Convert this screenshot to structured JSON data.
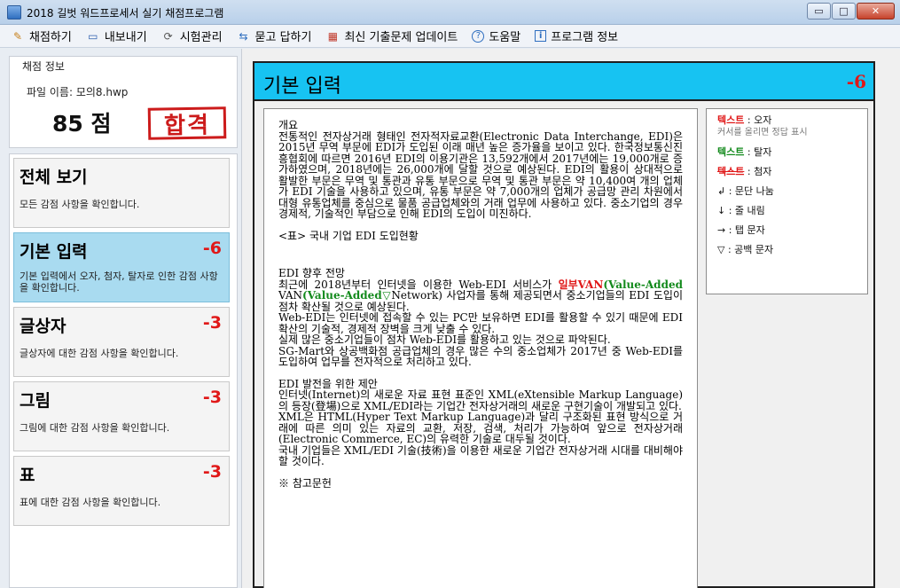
{
  "window": {
    "title": "2018 길벗 워드프로세서 실기 채점프로그램",
    "min": "▭",
    "max": "□",
    "close": "✕"
  },
  "menu": [
    {
      "icon": "✎",
      "label": "채점하기"
    },
    {
      "icon": "▭",
      "label": "내보내기"
    },
    {
      "icon": "⟳",
      "label": "시험관리"
    },
    {
      "icon": "⇆",
      "label": "묻고 답하기"
    },
    {
      "icon": "▦",
      "label": "최신 기출문제 업데이트"
    },
    {
      "icon": "?",
      "label": "도움말"
    },
    {
      "icon": "i",
      "label": "프로그램 정보"
    }
  ],
  "score_panel": {
    "legend": "채점 정보",
    "filename": "파일 이름: 모의8.hwp",
    "score": "85 점",
    "result": "합격"
  },
  "cards": [
    {
      "title": "전체 보기",
      "score": "",
      "desc": "모든 감점 사항을 확인합니다."
    },
    {
      "title": "기본 입력",
      "score": "-6",
      "desc": "기본 입력에서 오자, 첨자, 탈자로 인한 감점 사항을 확인합니다."
    },
    {
      "title": "글상자",
      "score": "-3",
      "desc": "글상자에 대한 감점 사항을 확인합니다."
    },
    {
      "title": "그림",
      "score": "-3",
      "desc": "그림에 대한 감점 사항을 확인합니다."
    },
    {
      "title": "표",
      "score": "-3",
      "desc": "표에 대한 감점 사항을 확인합니다."
    }
  ],
  "panel": {
    "title": "기본 입력",
    "score": "-6"
  },
  "doc": {
    "h1": "개요",
    "p1": "전통적인 전자상거래 형태인 전자적자료교환(Electronic Data Interchange, EDI)은 2015년 무역 부문에 EDI가 도입된 이래 매년 높은 증가율을 보이고 있다. 한국정보통신진흥협회에 따르면 2016년 EDI의 이용기관은 13,592개에서 2017년에는 19,000개로 증가하였으며, 2018년에는 26,000개에 달할 것으로 예상된다. EDI의 활용이 상대적으로 활발한 부문은 무역 및 통관과 유통 부문으로 무역 및 통관 부문은 약 10,400여 개의 업체가 EDI 기술을 사용하고 있으며, 유통 부문은 약 7,000개의 업체가 공급망 관리 차원에서 대형 유통업체를 중심으로 물품 공급업체와의 거래 업무에 사용하고 있다. 중소기업의 경우 경제적, 기술적인 부담으로 인해 EDI의 도입이 미진하다.",
    "table_caption": "<표> 국내 기업 EDI 도입현황",
    "h2": "EDI 향후 전망",
    "p2_a": "최근에 2018년부터 인터넷을 이용한 Web-EDI 서비스가 ",
    "p2_err": "일부VAN",
    "p2_miss1": "(Value-Added ",
    "p2_b": "VAN",
    "p2_miss2": "(Value-Added▽",
    "p2_c": "Network) 사업자를 통해 제공되면서 중소기업들의 EDI 도입이 점차 확산될 것으로 예상된다.",
    "p3": "Web-EDI는 인터넷에 접속할 수 있는 PC만 보유하면 EDI를 활용할 수 있기 때문에 EDI 확산의 기술적, 경제적 장벽을 크게 낮출 수 있다.",
    "p4": "실제 많은 중소기업들이 점차 Web-EDI를 활용하고 있는 것으로 파악된다.",
    "p5": "SG-Mart와 상공백화점 공급업체의 경우 많은 수의 중소업체가 2017년 중 Web-EDI를 도입하여 업무를 전자적으로 처리하고 있다.",
    "h3": "EDI 발전을 위한 제안",
    "p6": "인터넷(Internet)의 새로운 자료 표현 표준인 XML(eXtensible Markup Language)의 등장(登場)으로 XML/EDI라는 기업간 전자상거래의 새로운 구현기술이 개발되고 있다.",
    "p7": "XML은 HTML(Hyper Text Markup Language)과 달리 구조화된 표현 방식으로 거래에 따른 의미 있는 자료의 교환, 저장, 검색, 처리가 가능하여 앞으로 전자상거래(Electronic Commerce, EC)의 유력한 기술로 대두될 것이다.",
    "p8": "국내 기업들은 XML/EDI 기술(技術)을 이용한 새로운 기업간 전자상거래 시대를 대비해야 할 것이다.",
    "h4": "※ 참고문헌"
  },
  "legend": {
    "typo_word": "텍스트",
    "typo_label": " : 오자",
    "typo_hint": "커서를 올리면 정답 표시",
    "missing_word": "텍스트",
    "missing_label": " : 탈자",
    "extra_word": "텍스트",
    "extra_label": " : 첨자",
    "para": "↲ : 문단 나눔",
    "line": "↓ : 줄 내림",
    "tab": "→ : 탭 문자",
    "space": "▽ : 공백 문자"
  }
}
